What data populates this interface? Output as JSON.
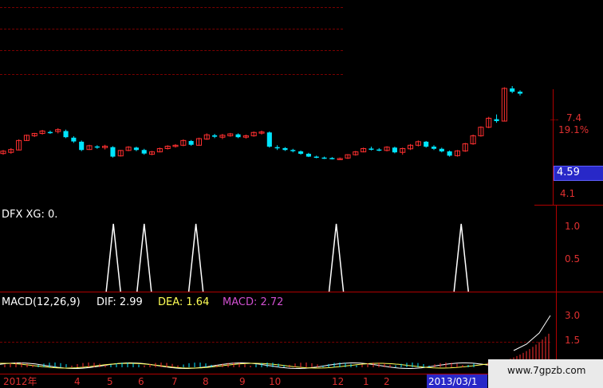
{
  "colors": {
    "background": "#000000",
    "grid": "#7a0000",
    "axis": "#b00000",
    "up_candle": "#ff3030",
    "down_candle": "#00e5ff",
    "signal_line": "#ffffff",
    "dif_color": "#ffffff",
    "dea_color": "#ffff55",
    "macd_color": "#d050d0",
    "price_box_bg": "#2828c8"
  },
  "price_panel": {
    "axis_labels": [
      "7.4",
      "19.1%",
      "4.1"
    ],
    "current_price_box": "4.59"
  },
  "signal_panel": {
    "title": "DFX XG: 0.",
    "axis_labels": [
      "1.0",
      "0.5"
    ],
    "signal_positions": [
      0.206,
      0.262,
      0.356,
      0.611,
      0.838
    ]
  },
  "macd_panel": {
    "name_label": "MACD(12,26,9)",
    "dif_label": "DIF: 2.99",
    "dea_label": "DEA: 1.64",
    "macd_label": "MACD: 2.72",
    "axis_labels": [
      "3.0",
      "1.5"
    ]
  },
  "date_axis": {
    "ticks": [
      "2012年",
      "4",
      "5",
      "6",
      "7",
      "8",
      "9",
      "10",
      "12",
      "1",
      "2"
    ],
    "selected_date": "2013/03/1"
  },
  "watermark": "www.7gpzb.com",
  "chart_data": {
    "type": "candlestick",
    "title": "",
    "ylim": [
      4.0,
      7.6
    ],
    "ohlc": [
      [
        4.75,
        4.9,
        4.7,
        4.85
      ],
      [
        4.8,
        4.98,
        4.74,
        4.92
      ],
      [
        4.9,
        5.35,
        4.88,
        5.3
      ],
      [
        5.3,
        5.55,
        5.28,
        5.52
      ],
      [
        5.5,
        5.62,
        5.45,
        5.6
      ],
      [
        5.6,
        5.75,
        5.55,
        5.7
      ],
      [
        5.66,
        5.72,
        5.58,
        5.64
      ],
      [
        5.68,
        5.82,
        5.6,
        5.76
      ],
      [
        5.7,
        5.76,
        5.4,
        5.44
      ],
      [
        5.42,
        5.48,
        5.2,
        5.26
      ],
      [
        5.25,
        5.3,
        4.85,
        4.9
      ],
      [
        4.92,
        5.12,
        4.9,
        5.08
      ],
      [
        5.05,
        5.1,
        4.95,
        5.0
      ],
      [
        5.0,
        5.12,
        4.92,
        5.06
      ],
      [
        5.02,
        5.06,
        4.58,
        4.62
      ],
      [
        4.65,
        4.9,
        4.62,
        4.88
      ],
      [
        4.88,
        5.06,
        4.85,
        5.02
      ],
      [
        5.0,
        5.04,
        4.85,
        4.9
      ],
      [
        4.9,
        4.95,
        4.7,
        4.75
      ],
      [
        4.72,
        4.86,
        4.68,
        4.82
      ],
      [
        4.82,
        5.0,
        4.8,
        4.96
      ],
      [
        4.96,
        5.1,
        4.92,
        5.06
      ],
      [
        5.06,
        5.15,
        5.0,
        5.1
      ],
      [
        5.1,
        5.35,
        5.06,
        5.3
      ],
      [
        5.28,
        5.32,
        5.08,
        5.12
      ],
      [
        5.1,
        5.42,
        5.08,
        5.38
      ],
      [
        5.36,
        5.6,
        5.33,
        5.54
      ],
      [
        5.52,
        5.58,
        5.4,
        5.46
      ],
      [
        5.44,
        5.58,
        5.36,
        5.52
      ],
      [
        5.5,
        5.62,
        5.46,
        5.58
      ],
      [
        5.56,
        5.6,
        5.4,
        5.44
      ],
      [
        5.44,
        5.55,
        5.38,
        5.5
      ],
      [
        5.5,
        5.68,
        5.46,
        5.64
      ],
      [
        5.62,
        5.72,
        5.55,
        5.66
      ],
      [
        5.64,
        5.68,
        5.0,
        5.04
      ],
      [
        5.02,
        5.1,
        4.9,
        5.0
      ],
      [
        4.98,
        5.02,
        4.86,
        4.9
      ],
      [
        4.9,
        4.95,
        4.8,
        4.86
      ],
      [
        4.84,
        4.88,
        4.7,
        4.74
      ],
      [
        4.74,
        4.78,
        4.6,
        4.62
      ],
      [
        4.62,
        4.66,
        4.55,
        4.58
      ],
      [
        4.58,
        4.62,
        4.52,
        4.56
      ],
      [
        4.56,
        4.6,
        4.5,
        4.55
      ],
      [
        4.54,
        4.58,
        4.5,
        4.54
      ],
      [
        4.56,
        4.72,
        4.52,
        4.7
      ],
      [
        4.7,
        4.86,
        4.66,
        4.82
      ],
      [
        4.82,
        5.0,
        4.8,
        4.96
      ],
      [
        4.96,
        5.04,
        4.88,
        4.92
      ],
      [
        4.92,
        4.98,
        4.85,
        4.9
      ],
      [
        4.88,
        5.06,
        4.84,
        5.02
      ],
      [
        5.0,
        5.04,
        4.76,
        4.8
      ],
      [
        4.8,
        5.0,
        4.7,
        4.96
      ],
      [
        4.95,
        5.15,
        4.9,
        5.1
      ],
      [
        5.1,
        5.3,
        5.05,
        5.25
      ],
      [
        5.25,
        5.28,
        5.0,
        5.04
      ],
      [
        5.04,
        5.1,
        4.9,
        4.95
      ],
      [
        4.95,
        5.0,
        4.8,
        4.84
      ],
      [
        4.84,
        4.88,
        4.62,
        4.66
      ],
      [
        4.66,
        4.9,
        4.62,
        4.86
      ],
      [
        4.86,
        5.2,
        4.82,
        5.16
      ],
      [
        5.16,
        5.55,
        5.12,
        5.5
      ],
      [
        5.5,
        5.9,
        5.46,
        5.86
      ],
      [
        5.86,
        6.3,
        5.82,
        6.24
      ],
      [
        6.2,
        6.4,
        6.05,
        6.12
      ],
      [
        6.12,
        7.55,
        6.1,
        7.5
      ],
      [
        7.5,
        7.6,
        7.3,
        7.36
      ],
      [
        7.36,
        7.42,
        7.2,
        7.28
      ]
    ]
  }
}
